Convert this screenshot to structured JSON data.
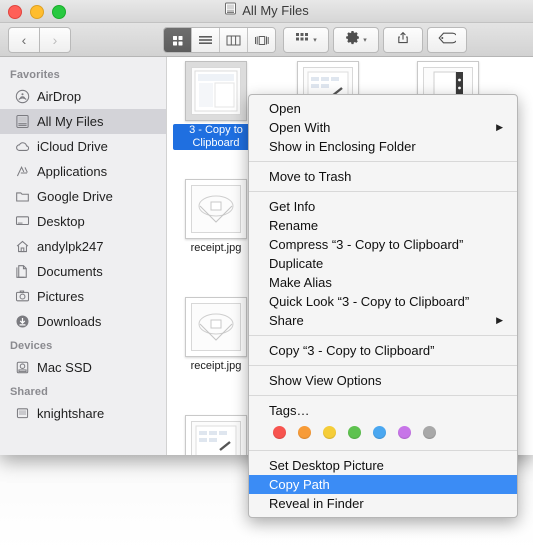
{
  "window": {
    "title": "All My Files",
    "title_icon": "all-my-files-icon",
    "traffic": {
      "close": "close",
      "minimize": "minimize",
      "zoom": "zoom"
    }
  },
  "toolbar": {
    "back": "‹",
    "forward": "›",
    "views": [
      {
        "name": "icon-view",
        "glyph": "∷",
        "active": true
      },
      {
        "name": "list-view",
        "glyph": "≡",
        "active": false
      },
      {
        "name": "column-view",
        "glyph": "⫼",
        "active": false
      },
      {
        "name": "coverflow-view",
        "glyph": "⧉",
        "active": false
      }
    ],
    "arrange_label": "arrange-icon",
    "action_label": "gear-icon",
    "share_label": "share-icon",
    "tag_label": "tag-icon",
    "caret": "▾"
  },
  "sidebar": {
    "sections": [
      {
        "header": "Favorites",
        "items": [
          {
            "label": "AirDrop",
            "icon": "airdrop-icon",
            "selected": false
          },
          {
            "label": "All My Files",
            "icon": "all-my-files-icon",
            "selected": true
          },
          {
            "label": "iCloud Drive",
            "icon": "icloud-icon",
            "selected": false
          },
          {
            "label": "Applications",
            "icon": "applications-icon",
            "selected": false
          },
          {
            "label": "Google Drive",
            "icon": "folder-icon",
            "selected": false
          },
          {
            "label": "Desktop",
            "icon": "desktop-icon",
            "selected": false
          },
          {
            "label": "andylpk247",
            "icon": "home-icon",
            "selected": false
          },
          {
            "label": "Documents",
            "icon": "documents-icon",
            "selected": false
          },
          {
            "label": "Pictures",
            "icon": "pictures-icon",
            "selected": false
          },
          {
            "label": "Downloads",
            "icon": "downloads-icon",
            "selected": false
          }
        ]
      },
      {
        "header": "Devices",
        "items": [
          {
            "label": "Mac SSD",
            "icon": "disk-icon",
            "selected": false
          }
        ]
      },
      {
        "header": "Shared",
        "items": [
          {
            "label": "knightshare",
            "icon": "shared-server-icon",
            "selected": false
          }
        ]
      }
    ]
  },
  "files": [
    {
      "label": "3 - Copy to Clipboard",
      "selected": true
    },
    {
      "label": "receipt.jpg",
      "selected": false
    },
    {
      "label": "receipt.jpg",
      "selected": false
    },
    {
      "label": "",
      "selected": false
    },
    {
      "label": "",
      "selected": false
    },
    {
      "label": "",
      "selected": false
    }
  ],
  "context_menu": {
    "groups": [
      {
        "items": [
          {
            "label": "Open",
            "submenu": false,
            "highlighted": false
          },
          {
            "label": "Open With",
            "submenu": true,
            "highlighted": false
          },
          {
            "label": "Show in Enclosing Folder",
            "submenu": false,
            "highlighted": false
          }
        ]
      },
      {
        "items": [
          {
            "label": "Move to Trash",
            "submenu": false,
            "highlighted": false
          }
        ]
      },
      {
        "items": [
          {
            "label": "Get Info",
            "submenu": false,
            "highlighted": false
          },
          {
            "label": "Rename",
            "submenu": false,
            "highlighted": false
          },
          {
            "label": "Compress “3 - Copy to Clipboard”",
            "submenu": false,
            "highlighted": false
          },
          {
            "label": "Duplicate",
            "submenu": false,
            "highlighted": false
          },
          {
            "label": "Make Alias",
            "submenu": false,
            "highlighted": false
          },
          {
            "label": "Quick Look “3 - Copy to Clipboard”",
            "submenu": false,
            "highlighted": false
          },
          {
            "label": "Share",
            "submenu": true,
            "highlighted": false
          }
        ]
      },
      {
        "items": [
          {
            "label": "Copy “3 - Copy to Clipboard”",
            "submenu": false,
            "highlighted": false
          }
        ]
      },
      {
        "items": [
          {
            "label": "Show View Options",
            "submenu": false,
            "highlighted": false
          }
        ]
      },
      {
        "items": [
          {
            "label": "Tags…",
            "submenu": false,
            "highlighted": false
          }
        ]
      },
      {
        "items": [
          {
            "label": "Set Desktop Picture",
            "submenu": false,
            "highlighted": false
          },
          {
            "label": "Copy Path",
            "submenu": false,
            "highlighted": true
          },
          {
            "label": "Reveal in Finder",
            "submenu": false,
            "highlighted": false
          }
        ]
      }
    ],
    "tag_colors": [
      "#f7544f",
      "#f79b37",
      "#f5cd38",
      "#5ec martian",
      "#4aa7f0",
      "#c775e8",
      "#a8a8a8"
    ],
    "tags": [
      {
        "name": "tag-red",
        "color": "#f7544f"
      },
      {
        "name": "tag-orange",
        "color": "#f79b37"
      },
      {
        "name": "tag-yellow",
        "color": "#f5cd38"
      },
      {
        "name": "tag-green",
        "color": "#5ec24f"
      },
      {
        "name": "tag-blue",
        "color": "#4aa7f0"
      },
      {
        "name": "tag-purple",
        "color": "#c775e8"
      },
      {
        "name": "tag-gray",
        "color": "#a8a8a8"
      }
    ],
    "highlight_color": "#3b8cf5"
  }
}
